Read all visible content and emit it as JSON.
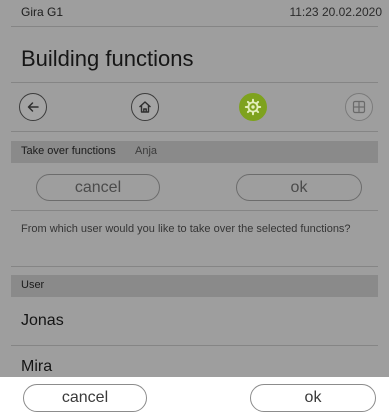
{
  "status": {
    "device_name": "Gira G1",
    "time_date": "11:23 20.02.2020"
  },
  "page": {
    "title": "Building functions"
  },
  "nav": [
    {
      "name": "back-icon"
    },
    {
      "name": "home-icon"
    },
    {
      "name": "gear-icon",
      "state": "active",
      "color": "#7ea21e"
    },
    {
      "name": "grid-icon",
      "state": "disabled"
    }
  ],
  "takeover": {
    "label": "Take over functions",
    "user": "Anja"
  },
  "dialog": {
    "cancel_label": "cancel",
    "ok_label": "ok",
    "question": "From which user would you like to take over the selected functions?"
  },
  "users_section": {
    "header": "User"
  },
  "users": [
    "Jonas",
    "Mira"
  ],
  "footer": {
    "cancel_label": "cancel",
    "ok_label": "ok"
  }
}
